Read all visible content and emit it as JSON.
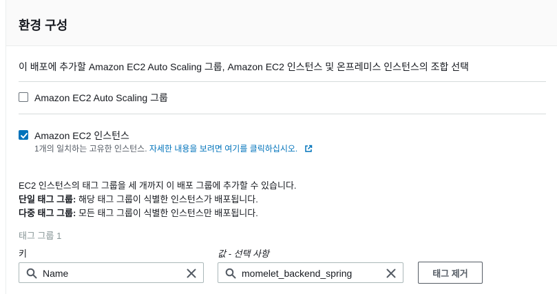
{
  "panel": {
    "title": "환경 구성",
    "description": "이 배포에 추가할 Amazon EC2 Auto Scaling 그룹, Amazon EC2 인스턴스 및 온프레미스 인스턴스의 조합 선택"
  },
  "options": {
    "asg": {
      "label": "Amazon EC2 Auto Scaling 그룹",
      "checked": false
    },
    "ec2": {
      "label": "Amazon EC2 인스턴스",
      "checked": true,
      "count_text": "1개의 일치하는 고유한 인스턴스.",
      "link_text": "자세한 내용을 보려면 여기를 클릭하십시오."
    }
  },
  "info": {
    "line1": "EC2 인스턴스의 태그 그룹을 세 개까지 이 배포 그룹에 추가할 수 있습니다.",
    "single_label": "단일 태그 그룹:",
    "single_text": " 해당 태그 그룹이 식별한 인스턴스가 배포됩니다.",
    "multi_label": "다중 태그 그룹:",
    "multi_text": " 모든 태그 그룹이 식별한 인스턴스만 배포됩니다."
  },
  "tag_group": {
    "title": "태그 그룹 1",
    "key_label": "키",
    "value_label": "값 - 선택 사항",
    "key_value": "Name",
    "value_value": "momelet_backend_spring",
    "remove_label": "태그 제거"
  },
  "colors": {
    "accent": "#0073bb",
    "text": "#16191f",
    "muted": "#879596"
  },
  "icons": {
    "search": "search-icon",
    "clear": "close-icon",
    "external": "external-link-icon",
    "check": "check-icon"
  }
}
